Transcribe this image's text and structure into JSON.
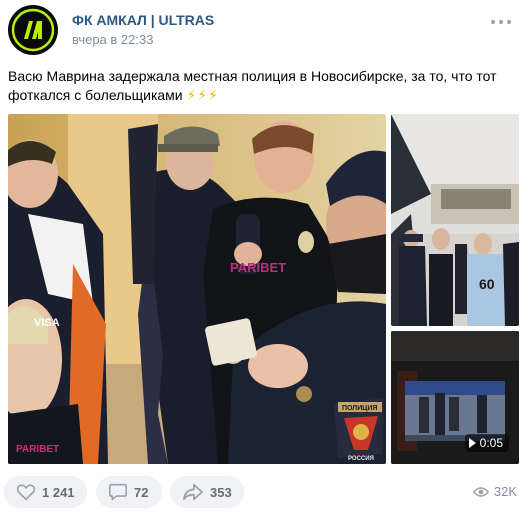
{
  "post": {
    "author": "ФК АМКАЛ | ULTRAS",
    "time": "вчера в 22:33",
    "text": "Васю Маврина задержала местная полиция в Новосибирске, за то, что тот фоткался с болельщиками",
    "emoji": "⚡⚡⚡",
    "avatar_letters": "AM"
  },
  "media": {
    "main_photo_alt": "group-photo",
    "video_duration": "0:05"
  },
  "photo_texts": {
    "jersey_sponsor_1": "PARIBET",
    "jersey_sponsor_2": "VISA",
    "jersey_sponsor_3": "PARIBET",
    "police_patch": "ПОЛИЦИЯ",
    "police_patch_country": "РОССИЯ",
    "jersey_number": "60"
  },
  "footer": {
    "likes": "1 241",
    "comments": "72",
    "shares": "353",
    "views": "32K"
  },
  "colors": {
    "link": "#2a5885",
    "muted": "#818c99",
    "button_bg": "#f0f2f5",
    "button_text": "#626d7a",
    "lightning": "#f5b400"
  }
}
